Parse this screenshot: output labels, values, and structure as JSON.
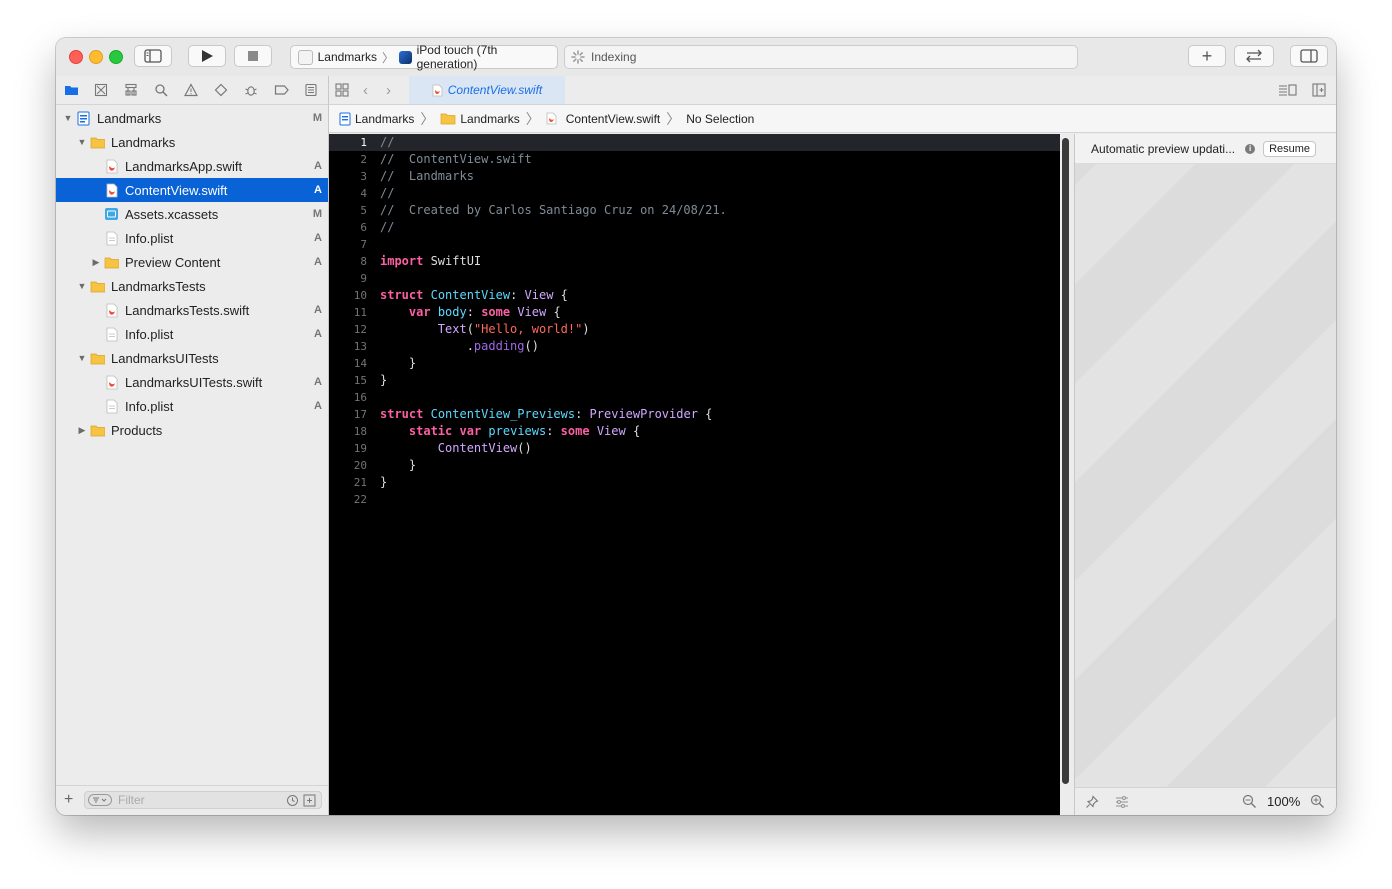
{
  "toolbar": {
    "scheme": "Landmarks",
    "device": "iPod touch (7th generation)",
    "activity": "Indexing",
    "add_icon": "plus-icon",
    "colors": {
      "close": "#fe5f57",
      "minimize": "#febc2e",
      "zoom": "#28c840"
    }
  },
  "navigator": {
    "tabs": [
      "folder-icon",
      "source-control-icon",
      "hierarchy-icon",
      "search-icon",
      "warning-icon",
      "test-icon",
      "debug-icon",
      "breakpoint-icon",
      "report-icon"
    ],
    "items": [
      {
        "label": "Landmarks",
        "badge": "M",
        "type": "project",
        "level": 0,
        "disclosure": "open"
      },
      {
        "label": "Landmarks",
        "badge": "",
        "type": "folder",
        "level": 1,
        "disclosure": "open"
      },
      {
        "label": "LandmarksApp.swift",
        "badge": "A",
        "type": "swift",
        "level": 2,
        "disclosure": ""
      },
      {
        "label": "ContentView.swift",
        "badge": "A",
        "type": "swift",
        "level": 2,
        "disclosure": "",
        "selected": true
      },
      {
        "label": "Assets.xcassets",
        "badge": "M",
        "type": "assets",
        "level": 2,
        "disclosure": ""
      },
      {
        "label": "Info.plist",
        "badge": "A",
        "type": "plist",
        "level": 2,
        "disclosure": ""
      },
      {
        "label": "Preview Content",
        "badge": "A",
        "type": "folder",
        "level": 2,
        "disclosure": "closed"
      },
      {
        "label": "LandmarksTests",
        "badge": "",
        "type": "folder",
        "level": 1,
        "disclosure": "open"
      },
      {
        "label": "LandmarksTests.swift",
        "badge": "A",
        "type": "swift",
        "level": 2,
        "disclosure": ""
      },
      {
        "label": "Info.plist",
        "badge": "A",
        "type": "plist",
        "level": 2,
        "disclosure": ""
      },
      {
        "label": "LandmarksUITests",
        "badge": "",
        "type": "folder",
        "level": 1,
        "disclosure": "open"
      },
      {
        "label": "LandmarksUITests.swift",
        "badge": "A",
        "type": "swift",
        "level": 2,
        "disclosure": ""
      },
      {
        "label": "Info.plist",
        "badge": "A",
        "type": "plist",
        "level": 2,
        "disclosure": ""
      },
      {
        "label": "Products",
        "badge": "",
        "type": "folder",
        "level": 1,
        "disclosure": "closed"
      }
    ],
    "filter_placeholder": "Filter"
  },
  "editor": {
    "tab_title": "ContentView.swift",
    "breadcrumb": [
      "Landmarks",
      "Landmarks",
      "ContentView.swift",
      "No Selection"
    ],
    "current_line": 1,
    "lines": [
      [
        [
          "c",
          "//"
        ]
      ],
      [
        [
          "c",
          "//  ContentView.swift"
        ]
      ],
      [
        [
          "c",
          "//  Landmarks"
        ]
      ],
      [
        [
          "c",
          "//"
        ]
      ],
      [
        [
          "c",
          "//  Created by Carlos Santiago Cruz on 24/08/21."
        ]
      ],
      [
        [
          "c",
          "//"
        ]
      ],
      [],
      [
        [
          "k",
          "import"
        ],
        [
          "p",
          " SwiftUI"
        ]
      ],
      [],
      [
        [
          "k",
          "struct"
        ],
        [
          "p",
          " "
        ],
        [
          "t",
          "ContentView"
        ],
        [
          "p",
          ": "
        ],
        [
          "r",
          "View"
        ],
        [
          "p",
          " {"
        ]
      ],
      [
        [
          "p",
          "    "
        ],
        [
          "k",
          "var"
        ],
        [
          "p",
          " "
        ],
        [
          "t",
          "body"
        ],
        [
          "p",
          ": "
        ],
        [
          "k",
          "some"
        ],
        [
          "p",
          " "
        ],
        [
          "r",
          "View"
        ],
        [
          "p",
          " {"
        ]
      ],
      [
        [
          "p",
          "        "
        ],
        [
          "r",
          "Text"
        ],
        [
          "p",
          "("
        ],
        [
          "s",
          "\"Hello, world!\""
        ],
        [
          "p",
          ")"
        ]
      ],
      [
        [
          "p",
          "            ."
        ],
        [
          "m",
          "padding"
        ],
        [
          "p",
          "()"
        ]
      ],
      [
        [
          "p",
          "    }"
        ]
      ],
      [
        [
          "p",
          "}"
        ]
      ],
      [],
      [
        [
          "k",
          "struct"
        ],
        [
          "p",
          " "
        ],
        [
          "t",
          "ContentView_Previews"
        ],
        [
          "p",
          ": "
        ],
        [
          "r",
          "PreviewProvider"
        ],
        [
          "p",
          " {"
        ]
      ],
      [
        [
          "p",
          "    "
        ],
        [
          "k",
          "static"
        ],
        [
          "p",
          " "
        ],
        [
          "k",
          "var"
        ],
        [
          "p",
          " "
        ],
        [
          "t",
          "previews"
        ],
        [
          "p",
          ": "
        ],
        [
          "k",
          "some"
        ],
        [
          "p",
          " "
        ],
        [
          "r",
          "View"
        ],
        [
          "p",
          " {"
        ]
      ],
      [
        [
          "p",
          "        "
        ],
        [
          "x",
          "ContentView"
        ],
        [
          "p",
          "()"
        ]
      ],
      [
        [
          "p",
          "    }"
        ]
      ],
      [
        [
          "p",
          "}"
        ]
      ],
      []
    ]
  },
  "canvas": {
    "status": "Automatic preview updati...",
    "resume_label": "Resume",
    "zoom": "100%"
  }
}
